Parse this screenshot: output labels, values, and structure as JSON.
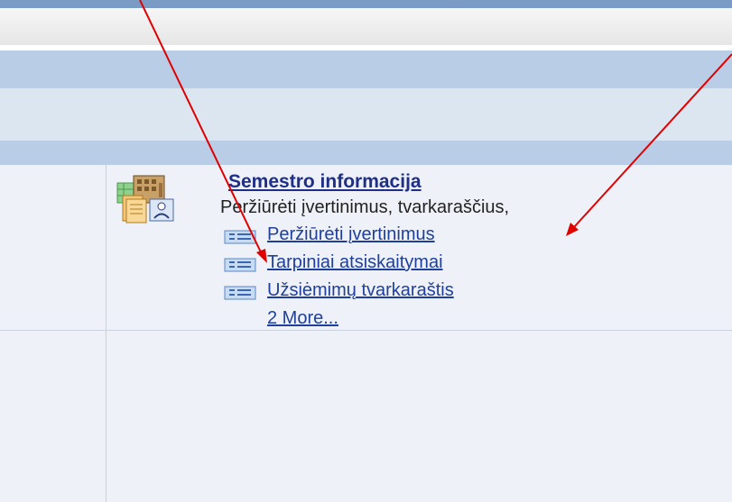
{
  "section": {
    "icon": "documents-building-person-icon",
    "title": "Semestro informacija",
    "description": "Peržiūrėti įvertinimus, tvarkaraščius,",
    "links": [
      {
        "label": "Peržiūrėti įvertinimus",
        "icon": "list-item-icon"
      },
      {
        "label": "Tarpiniai atsiskaitymai",
        "icon": "list-item-icon"
      },
      {
        "label": "Užsiėmimų tvarkaraštis",
        "icon": "list-item-icon"
      }
    ],
    "more_label": "2 More..."
  },
  "annotation": {
    "arrow_color": "#e00000"
  }
}
